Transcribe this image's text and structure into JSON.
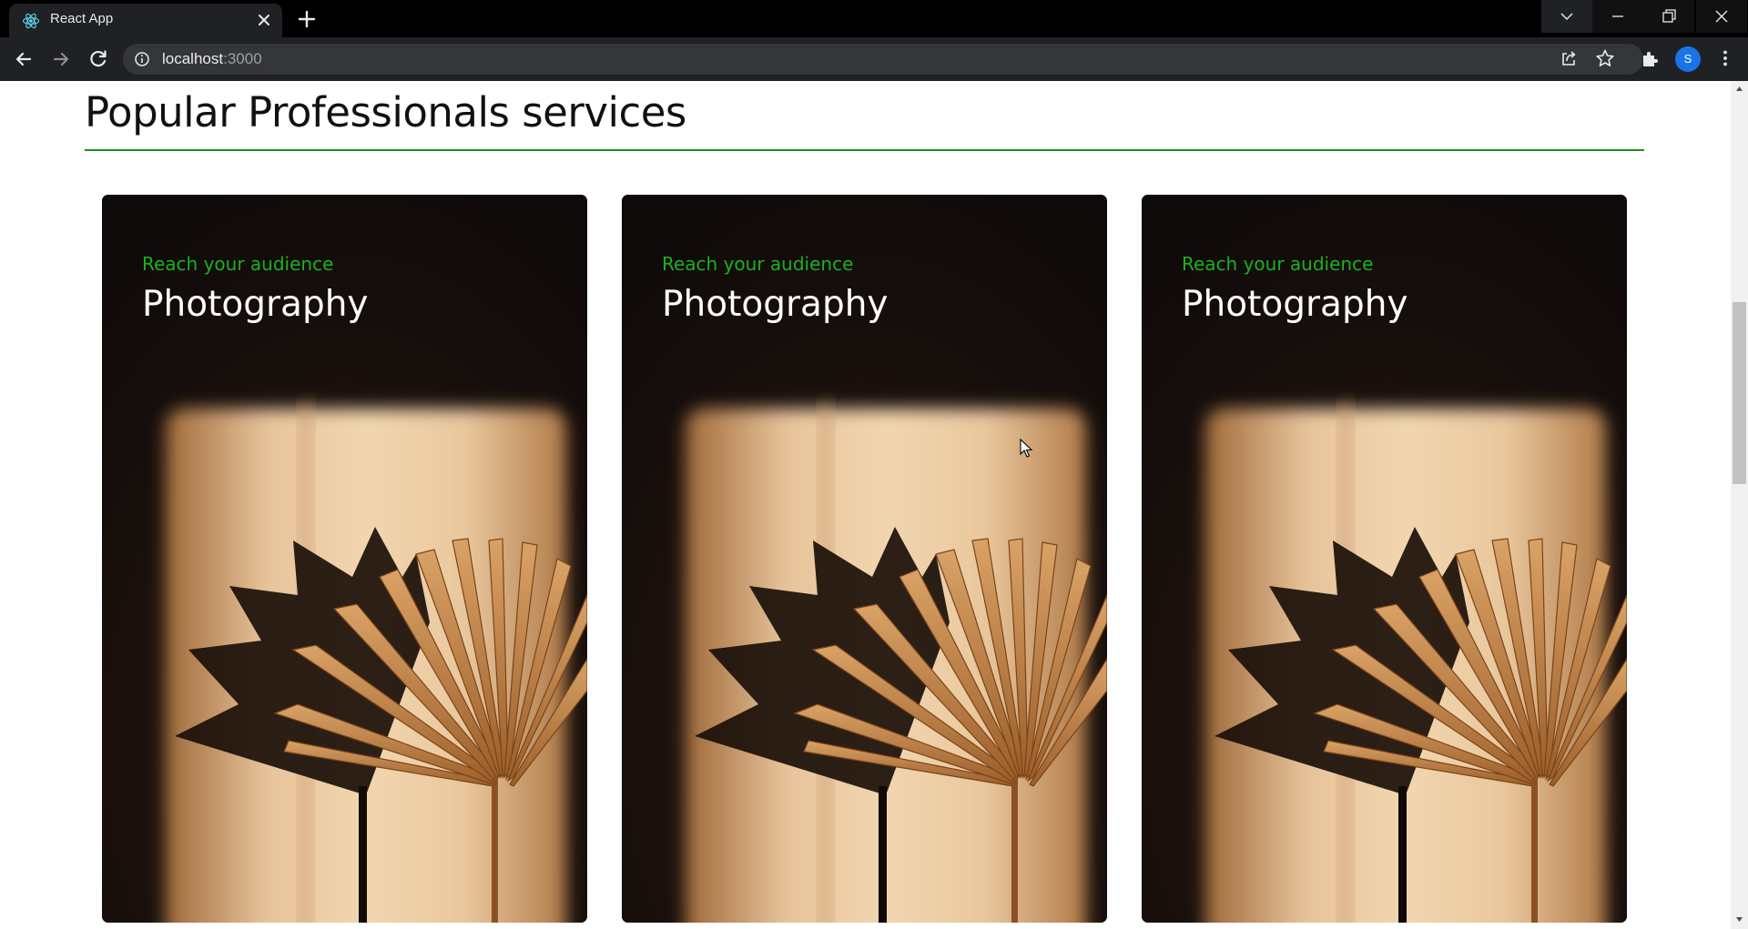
{
  "browser": {
    "tab_title": "React App",
    "url_host": "localhost",
    "url_port": ":3000",
    "profile_initial": "S",
    "accent": "#1a73e8"
  },
  "page": {
    "section_title": "Popular Professionals services",
    "rule_color": "#1f8a1f",
    "cards": [
      {
        "kicker": "Reach your audience",
        "heading": "Photography"
      },
      {
        "kicker": "Reach your audience",
        "heading": "Photography"
      },
      {
        "kicker": "Reach your audience",
        "heading": "Photography"
      }
    ]
  },
  "icons": [
    "react-icon",
    "close-icon",
    "plus-icon",
    "chevron-down-icon",
    "minimize-icon",
    "restore-icon",
    "back-icon",
    "forward-icon",
    "reload-icon",
    "info-icon",
    "share-icon",
    "star-icon",
    "extensions-icon",
    "kebab-menu-icon"
  ]
}
